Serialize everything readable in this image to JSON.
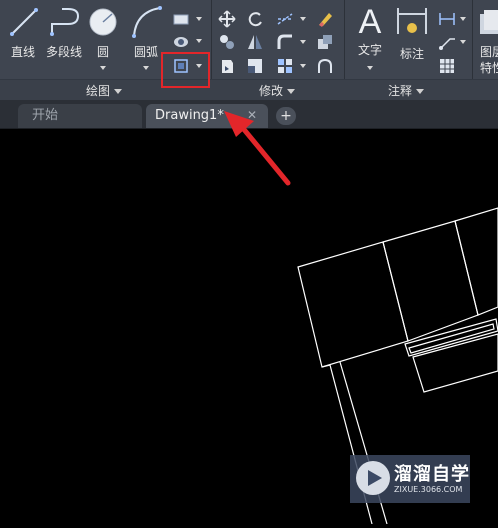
{
  "ribbon": {
    "draw_panel": {
      "title": "绘图",
      "tools": [
        {
          "label": "直线",
          "icon": "line-icon"
        },
        {
          "label": "多段线",
          "icon": "polyline-icon"
        },
        {
          "label": "圆",
          "icon": "circle-icon"
        },
        {
          "label": "圆弧",
          "icon": "arc-icon"
        }
      ]
    },
    "modify_panel": {
      "title": "修改"
    },
    "annotation_panel": {
      "title": "注释",
      "tools": [
        {
          "label": "文字",
          "icon": "text-icon"
        },
        {
          "label": "标注",
          "icon": "dimension-icon"
        }
      ]
    },
    "layers_panel": {
      "label_line1": "图层",
      "label_line2": "特性"
    }
  },
  "tabs": {
    "start": "开始",
    "drawing": "Drawing1*",
    "close": "✕",
    "add": "+"
  },
  "watermark": {
    "title": "溜溜自学",
    "subtitle": "ZIXUE.3066.COM"
  },
  "colors": {
    "ribbon_bg": "#3f4550",
    "canvas_bg": "#000000",
    "highlight": "#e3262a",
    "geometry": "#ffffff"
  }
}
